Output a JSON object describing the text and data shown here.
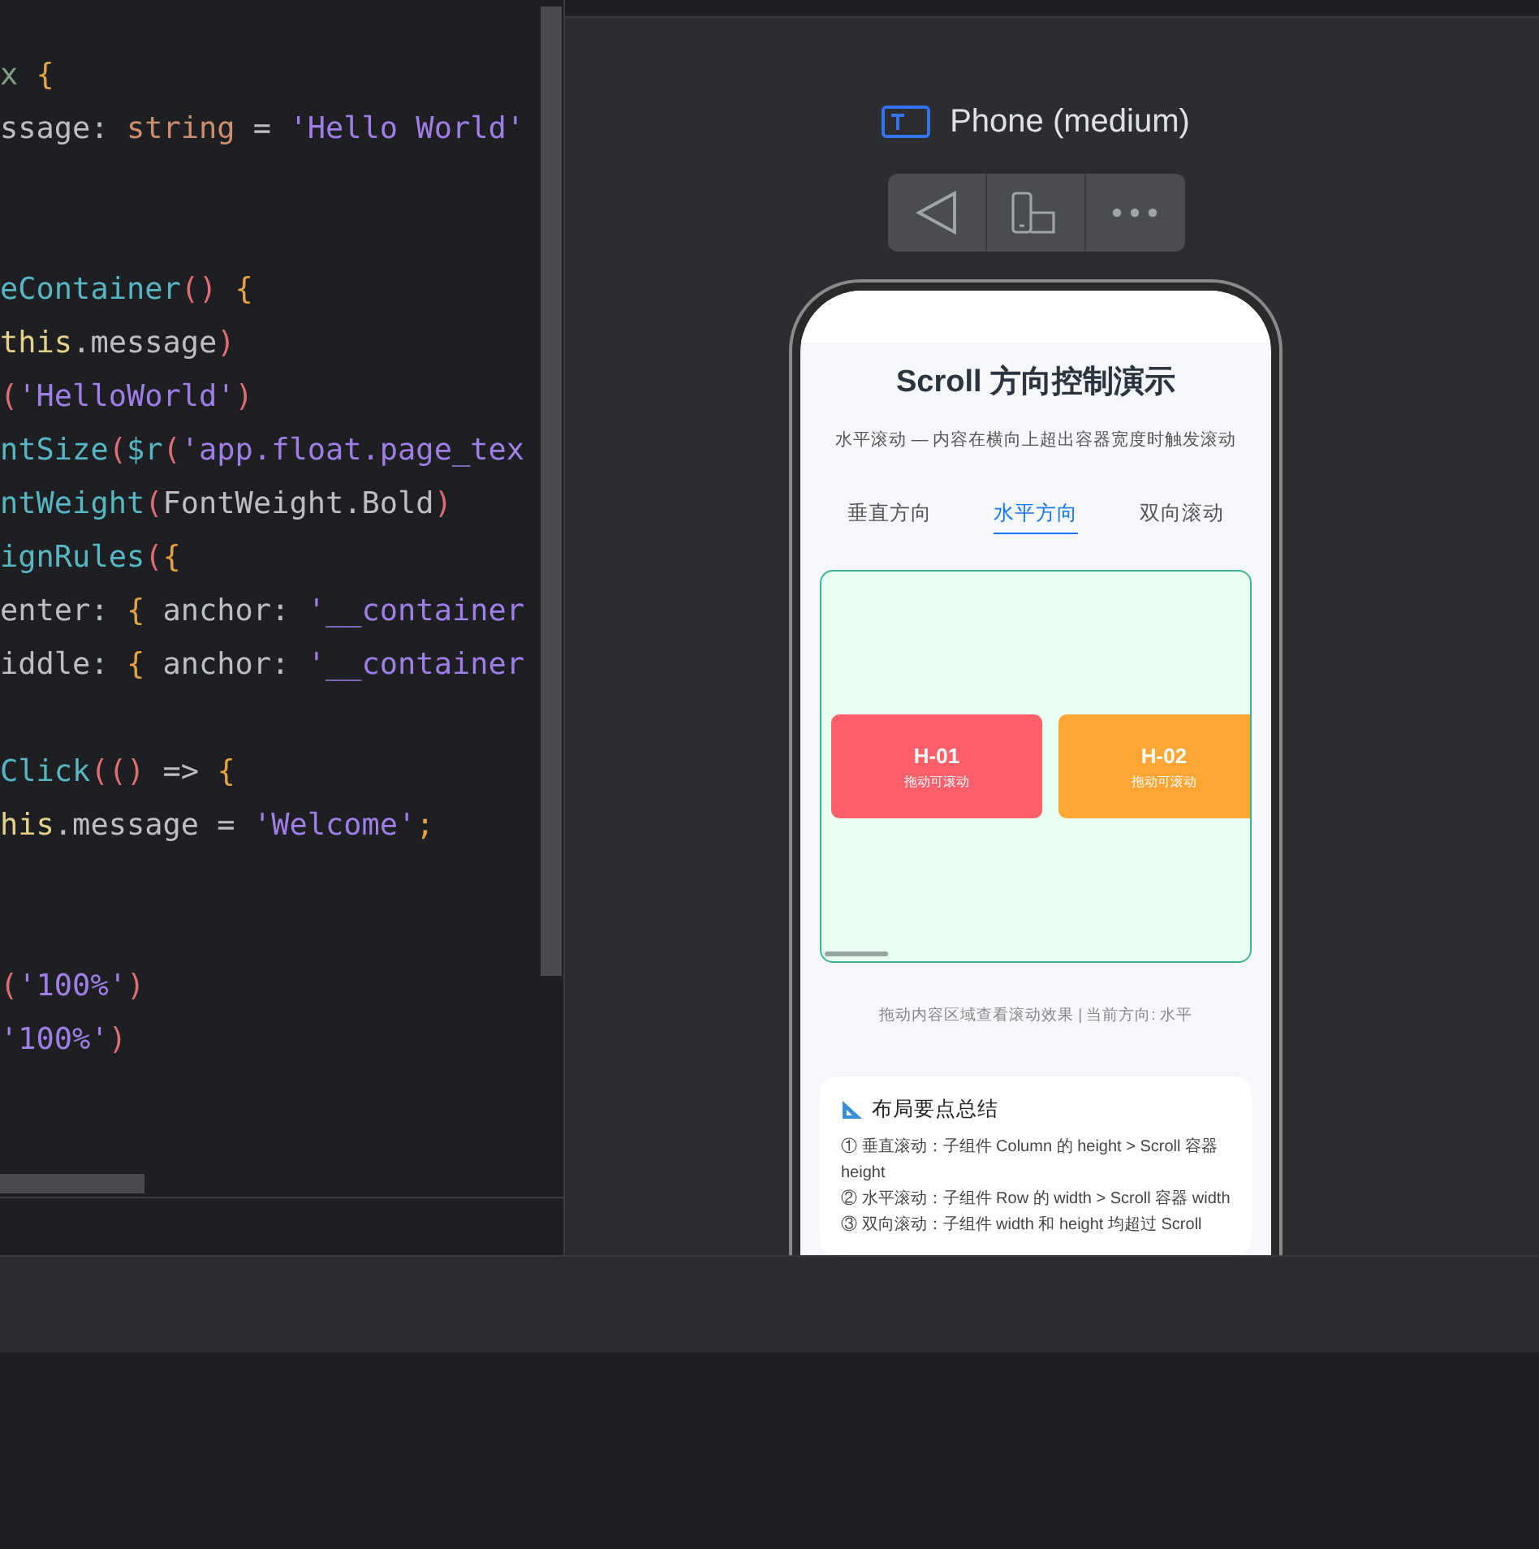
{
  "editor": {
    "lines": [
      {
        "kind": "code",
        "tokens": [
          {
            "text": "x",
            "kind": "muted"
          },
          {
            "text": " {",
            "kind": "brace"
          }
        ]
      },
      {
        "kind": "code",
        "tokens": [
          {
            "text": "ssage: ",
            "kind": "plain"
          },
          {
            "text": "string",
            "kind": "keyword"
          },
          {
            "text": " = ",
            "kind": "plain"
          },
          {
            "text": "'Hello World'",
            "kind": "string"
          }
        ]
      },
      {
        "kind": "blank"
      },
      {
        "kind": "blank"
      },
      {
        "kind": "code",
        "tokens": [
          {
            "text": "eContainer",
            "kind": "func"
          },
          {
            "text": "()",
            "kind": "paren"
          },
          {
            "text": " {",
            "kind": "brace"
          }
        ]
      },
      {
        "kind": "code",
        "tokens": [
          {
            "text": "this",
            "kind": "this"
          },
          {
            "text": ".message",
            "kind": "plain"
          },
          {
            "text": ")",
            "kind": "paren"
          }
        ]
      },
      {
        "kind": "code",
        "tokens": [
          {
            "text": "(",
            "kind": "paren"
          },
          {
            "text": "'HelloWorld'",
            "kind": "string"
          },
          {
            "text": ")",
            "kind": "paren"
          }
        ]
      },
      {
        "kind": "code",
        "tokens": [
          {
            "text": "ntSize",
            "kind": "func"
          },
          {
            "text": "(",
            "kind": "paren"
          },
          {
            "text": "$r",
            "kind": "func"
          },
          {
            "text": "(",
            "kind": "paren"
          },
          {
            "text": "'app.float.page_tex",
            "kind": "string"
          }
        ]
      },
      {
        "kind": "code",
        "tokens": [
          {
            "text": "ntWeight",
            "kind": "func"
          },
          {
            "text": "(",
            "kind": "paren"
          },
          {
            "text": "FontWeight.Bold",
            "kind": "plain"
          },
          {
            "text": ")",
            "kind": "paren"
          }
        ]
      },
      {
        "kind": "code",
        "tokens": [
          {
            "text": "ignRules",
            "kind": "func"
          },
          {
            "text": "(",
            "kind": "paren"
          },
          {
            "text": "{",
            "kind": "brace"
          }
        ]
      },
      {
        "kind": "code",
        "tokens": [
          {
            "text": "enter: ",
            "kind": "plain"
          },
          {
            "text": "{",
            "kind": "brace"
          },
          {
            "text": " anchor: ",
            "kind": "plain"
          },
          {
            "text": "'__container",
            "kind": "string"
          }
        ]
      },
      {
        "kind": "code",
        "tokens": [
          {
            "text": "iddle: ",
            "kind": "plain"
          },
          {
            "text": "{",
            "kind": "brace"
          },
          {
            "text": " anchor: ",
            "kind": "plain"
          },
          {
            "text": "'__container",
            "kind": "string"
          }
        ]
      },
      {
        "kind": "blank"
      },
      {
        "kind": "code",
        "tokens": [
          {
            "text": "Click",
            "kind": "func"
          },
          {
            "text": "(()",
            "kind": "paren"
          },
          {
            "text": " => ",
            "kind": "plain"
          },
          {
            "text": "{",
            "kind": "brace"
          }
        ]
      },
      {
        "kind": "code",
        "tokens": [
          {
            "text": "his",
            "kind": "this"
          },
          {
            "text": ".message = ",
            "kind": "plain"
          },
          {
            "text": "'Welcome'",
            "kind": "string"
          },
          {
            "text": ";",
            "kind": "brace"
          }
        ]
      },
      {
        "kind": "blank"
      },
      {
        "kind": "blank"
      },
      {
        "kind": "code",
        "tokens": [
          {
            "text": "(",
            "kind": "paren"
          },
          {
            "text": "'100%'",
            "kind": "string"
          },
          {
            "text": ")",
            "kind": "paren"
          }
        ]
      },
      {
        "kind": "code",
        "tokens": [
          {
            "text": "'100%'",
            "kind": "string"
          },
          {
            "text": ")",
            "kind": "paren"
          }
        ]
      }
    ]
  },
  "preview": {
    "device_label": "Phone (medium)",
    "app": {
      "title": "Scroll 方向控制演示",
      "subtitle": "水平滚动 — 内容在横向上超出容器宽度时触发滚动",
      "tabs": [
        {
          "label": "垂直方向",
          "selected": false
        },
        {
          "label": "水平方向",
          "selected": true
        },
        {
          "label": "双向滚动",
          "selected": false
        }
      ],
      "cards": [
        {
          "title": "H-01",
          "subtitle": "拖动可滚动",
          "color": "#ff5f68"
        },
        {
          "title": "H-02",
          "subtitle": "拖动可滚动",
          "color": "#ffa533"
        }
      ],
      "caption": "拖动内容区域查看滚动效果 | 当前方向: 水平",
      "summary": {
        "title": "布局要点总结",
        "lines": [
          "① 垂直滚动：子组件 Column 的 height > Scroll 容器 height",
          "② 水平滚动：子组件 Row  的 width  > Scroll 容器 width",
          "③ 双向滚动：子组件 width 和 height 均超过 Scroll"
        ]
      }
    }
  }
}
